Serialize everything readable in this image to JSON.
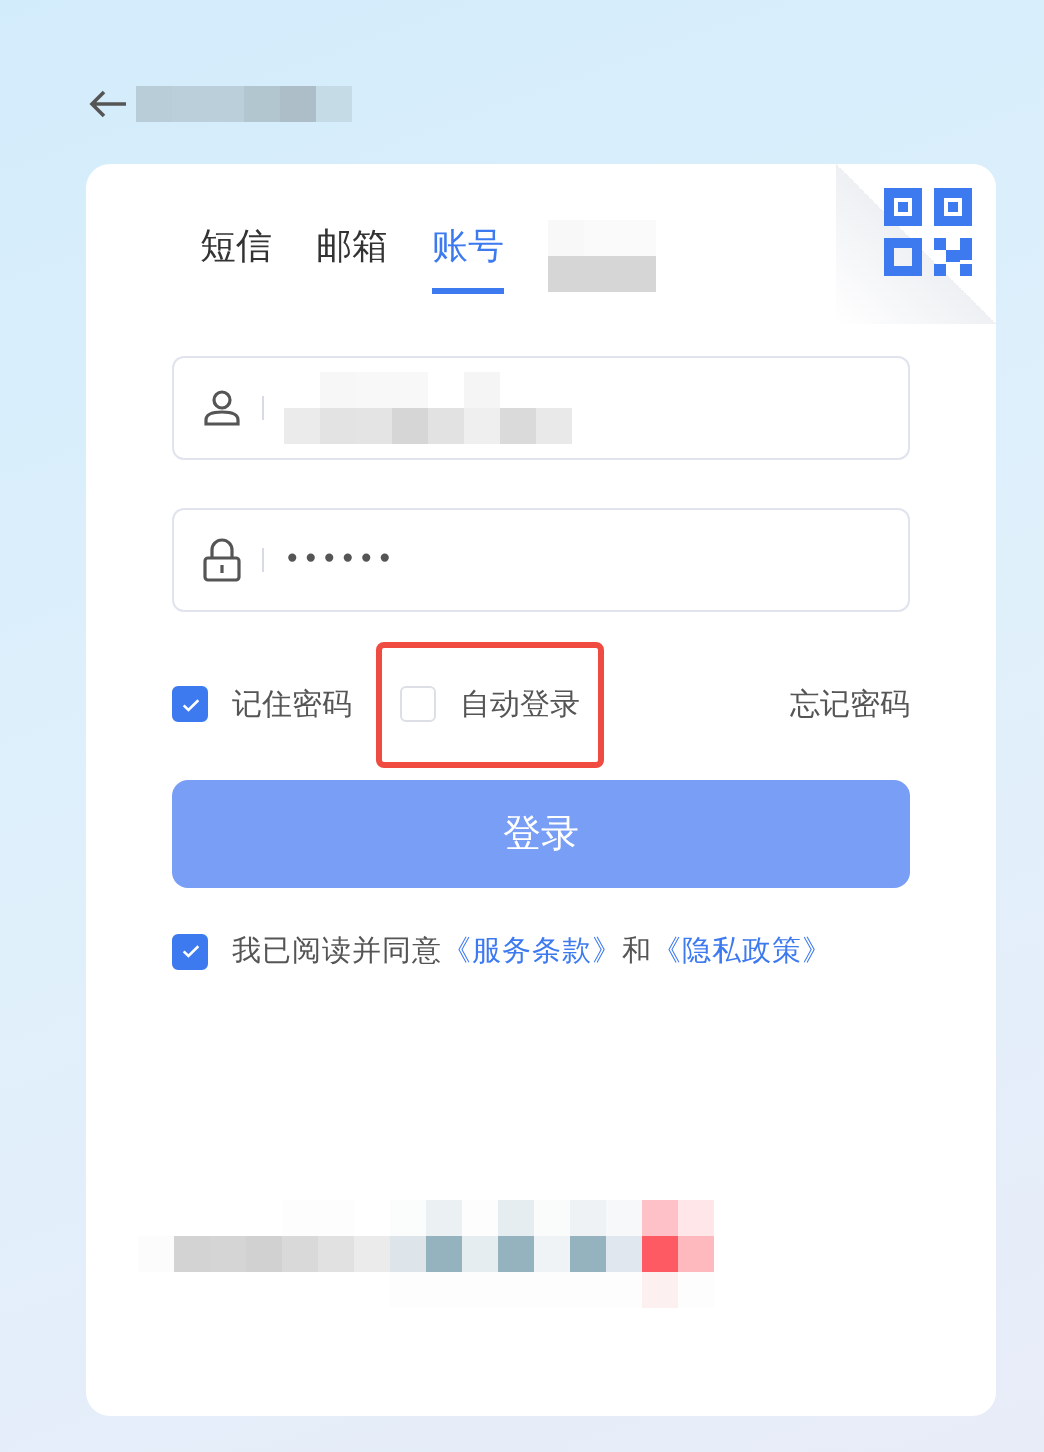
{
  "tabs": [
    {
      "label": "短信",
      "selected": false
    },
    {
      "label": "邮箱",
      "selected": false
    },
    {
      "label": "账号",
      "selected": true
    }
  ],
  "password": {
    "value": "••••••"
  },
  "options": [
    {
      "label": "记住密码",
      "checked": true,
      "highlighted": false
    },
    {
      "label": "自动登录",
      "checked": false,
      "highlighted": true
    }
  ],
  "forgot_link": "忘记密码",
  "login_button": "登录",
  "agreement": {
    "checked": true,
    "text": "我已阅读并同意",
    "links": [
      "《服务条款》",
      "《隐私政策》"
    ],
    "joiner": "和"
  }
}
